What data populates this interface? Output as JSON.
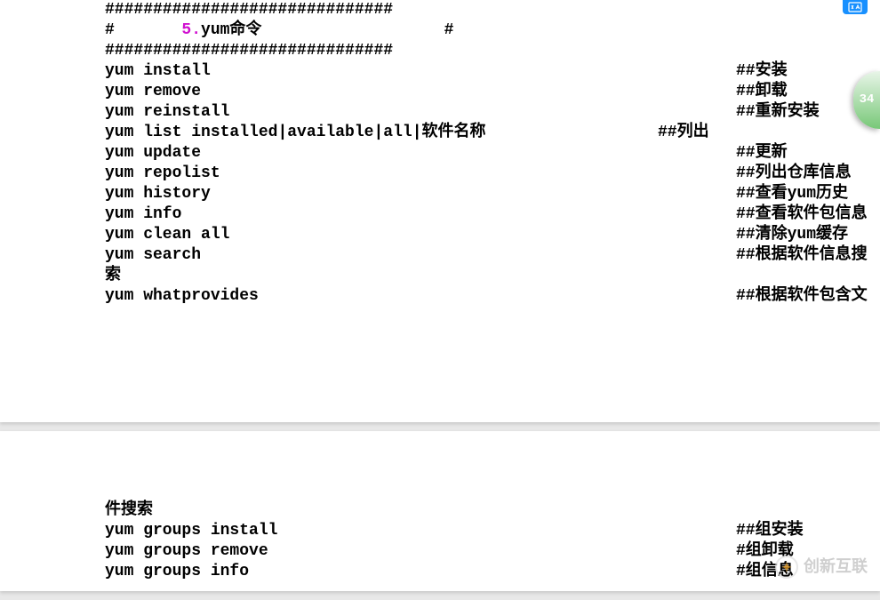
{
  "header": {
    "border_top": "##############################",
    "title_left": "#       ",
    "title_num": "5.",
    "title_text": "yum命令",
    "title_right": "                   #",
    "border_bottom": "##############################"
  },
  "page1": {
    "lines": [
      {
        "cmd": "yum install",
        "comment": "##安装"
      },
      {
        "cmd": "yum remove",
        "comment": "##卸载"
      },
      {
        "cmd": "yum reinstall",
        "comment": "##重新安装"
      },
      {
        "cmd_parts": [
          "yum list installed",
          "|",
          "available",
          "|",
          "all",
          "|",
          "软件名称"
        ],
        "comment_near": "##列出"
      },
      {
        "cmd": "yum update",
        "comment": "##更新"
      },
      {
        "cmd": "yum repolist",
        "comment": "##列出仓库信息"
      },
      {
        "cmd": "yum history",
        "comment": "##查看yum历史"
      },
      {
        "cmd": "yum info",
        "comment": "##查看软件包信息"
      },
      {
        "cmd": "yum clean all",
        "comment": "##清除yum缓存"
      },
      {
        "cmd": "yum search",
        "comment": "##根据软件信息搜"
      },
      {
        "cmd": "索",
        "comment": ""
      },
      {
        "cmd": "yum whatprovides",
        "comment": "##根据软件包含文"
      }
    ]
  },
  "page2": {
    "lines": [
      {
        "cmd": "件搜索",
        "comment": ""
      },
      {
        "cmd": "yum groups install",
        "comment": "##组安装"
      },
      {
        "cmd": "yum groups remove",
        "comment": "#组卸载"
      },
      {
        "cmd": "yum groups info",
        "comment": "#组信息"
      }
    ]
  },
  "badge": {
    "text": "34"
  },
  "watermark": {
    "text": "创新互联"
  }
}
